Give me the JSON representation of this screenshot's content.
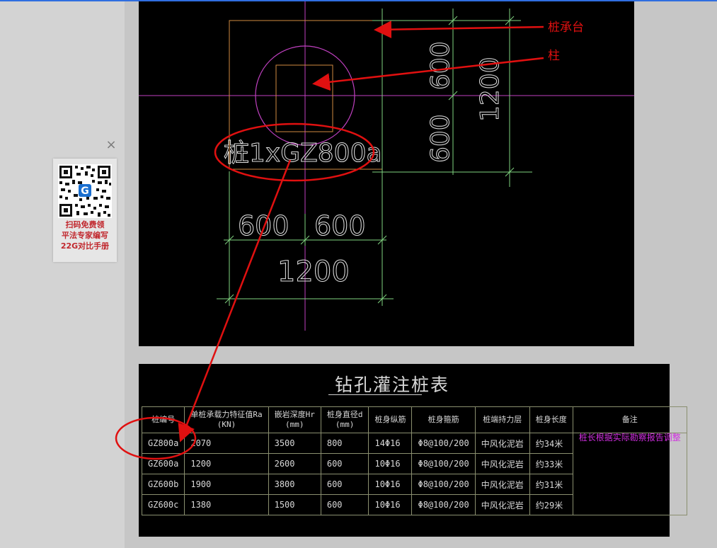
{
  "promo": {
    "close_glyph": "×",
    "line1": "扫码免费领",
    "line2": "平法专家编写",
    "line3": "22G对比手册",
    "brand_mark": "G"
  },
  "drawing": {
    "label_cap": "桩承台",
    "label_column": "柱",
    "pile_mark": "桩1xGZ800a",
    "dim_600_a": "600",
    "dim_600_b": "600",
    "dim_1200_bottom": "1200",
    "dim_600_c": "600",
    "dim_600_d": "600",
    "dim_1200_right": "1200"
  },
  "table": {
    "title": "钻孔灌注桩表",
    "headers": [
      "桩编号",
      "单桩承载力特征值Ra\n(KN)",
      "嵌岩深度Hr\n(mm)",
      "桩身直径d\n(mm)",
      "桩身纵筋",
      "桩身箍筋",
      "桩端持力层",
      "桩身长度",
      "备注"
    ],
    "rows": [
      [
        "GZ800a",
        "2070",
        "3500",
        "800",
        "14Φ16",
        "Φ8@100/200",
        "中风化泥岩",
        "约34米"
      ],
      [
        "GZ600a",
        "1200",
        "2600",
        "600",
        "10Φ16",
        "Φ8@100/200",
        "中风化泥岩",
        "约33米"
      ],
      [
        "GZ600b",
        "1900",
        "3800",
        "600",
        "10Φ16",
        "Φ8@100/200",
        "中风化泥岩",
        "约31米"
      ],
      [
        "GZ600c",
        "1380",
        "1500",
        "600",
        "10Φ16",
        "Φ8@100/200",
        "中风化泥岩",
        "约29米"
      ]
    ],
    "remark": "桩长根据实际勘察报告调整"
  },
  "colors": {
    "annotation_red": "#e01010",
    "cad_green": "#7fd37f",
    "cad_magenta": "#c040c0",
    "cad_orange": "#d08a40",
    "cad_grey": "#cfcfcf"
  }
}
